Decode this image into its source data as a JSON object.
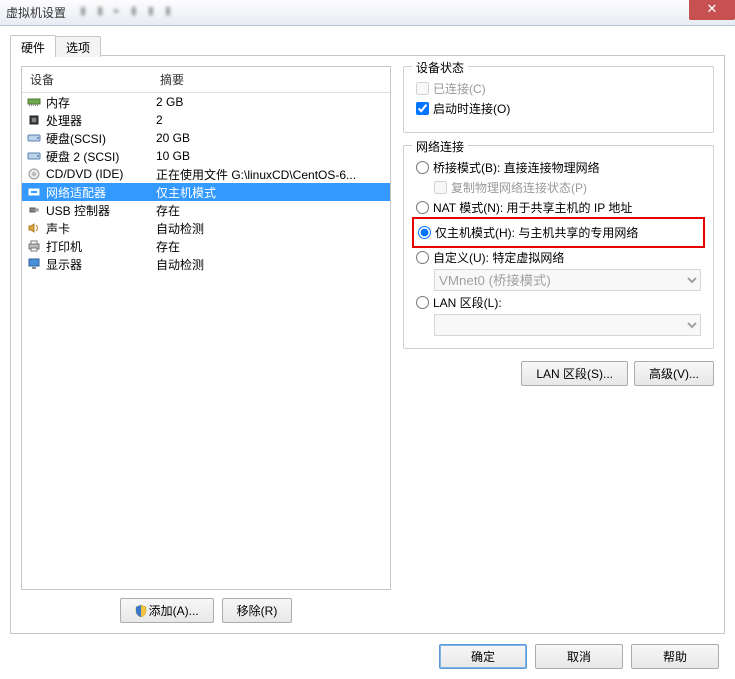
{
  "window": {
    "title": "虚拟机设置"
  },
  "tabs": {
    "hardware": "硬件",
    "options": "选项"
  },
  "headers": {
    "device": "设备",
    "summary": "摘要"
  },
  "hw": [
    {
      "icon": "memory",
      "name": "内存",
      "summary": "2 GB"
    },
    {
      "icon": "cpu",
      "name": "处理器",
      "summary": "2"
    },
    {
      "icon": "disk",
      "name": "硬盘(SCSI)",
      "summary": "20 GB"
    },
    {
      "icon": "disk",
      "name": "硬盘 2 (SCSI)",
      "summary": "10 GB"
    },
    {
      "icon": "cd",
      "name": "CD/DVD (IDE)",
      "summary": "正在使用文件 G:\\linuxCD\\CentOS-6..."
    },
    {
      "icon": "net",
      "name": "网络适配器",
      "summary": "仅主机模式",
      "selected": true
    },
    {
      "icon": "usb",
      "name": "USB 控制器",
      "summary": "存在"
    },
    {
      "icon": "sound",
      "name": "声卡",
      "summary": "自动检测"
    },
    {
      "icon": "printer",
      "name": "打印机",
      "summary": "存在"
    },
    {
      "icon": "display",
      "name": "显示器",
      "summary": "自动检测"
    }
  ],
  "buttons": {
    "add": "添加(A)...",
    "remove": "移除(R)",
    "lanseg": "LAN 区段(S)...",
    "advanced": "高级(V)...",
    "ok": "确定",
    "cancel": "取消",
    "help": "帮助"
  },
  "status": {
    "legend": "设备状态",
    "connected": "已连接(C)",
    "connect_on": "启动时连接(O)"
  },
  "net": {
    "legend": "网络连接",
    "bridge": "桥接模式(B): 直接连接物理网络",
    "replicate": "复制物理网络连接状态(P)",
    "nat": "NAT 模式(N): 用于共享主机的 IP 地址",
    "hostonly": "仅主机模式(H): 与主机共享的专用网络",
    "custom": "自定义(U): 特定虚拟网络",
    "vmnet": "VMnet0 (桥接模式)",
    "lan": "LAN 区段(L):"
  }
}
